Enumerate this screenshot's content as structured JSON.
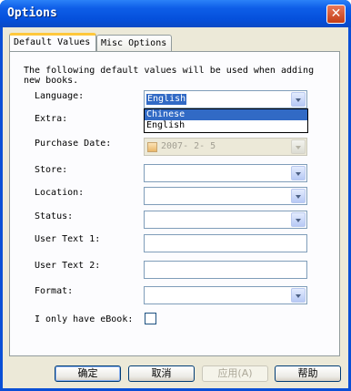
{
  "window": {
    "title": "Options",
    "close_glyph": "✕"
  },
  "tabs": [
    {
      "label": "Default Values",
      "active": true
    },
    {
      "label": "Misc Options",
      "active": false
    }
  ],
  "description": "The following default values will be used when adding new books.",
  "fields": {
    "language": {
      "label": "Language:",
      "value": "English",
      "options": [
        "Chinese",
        "English"
      ],
      "highlighted": "Chinese"
    },
    "extra": {
      "label": "Extra:"
    },
    "purchase_date": {
      "label": "Purchase Date:",
      "value": "2007- 2- 5"
    },
    "store": {
      "label": "Store:"
    },
    "location": {
      "label": "Location:"
    },
    "status": {
      "label": "Status:"
    },
    "user_text_1": {
      "label": "User Text 1:"
    },
    "user_text_2": {
      "label": "User Text 2:"
    },
    "format": {
      "label": "Format:"
    },
    "only_ebook": {
      "label": "I only have eBook:",
      "checked": false
    }
  },
  "buttons": {
    "ok": "确定",
    "cancel": "取消",
    "apply": "应用(A)",
    "help": "帮助"
  },
  "icons": [
    "close-icon",
    "dropdown-arrow-icon",
    "date-checkbox-icon"
  ]
}
